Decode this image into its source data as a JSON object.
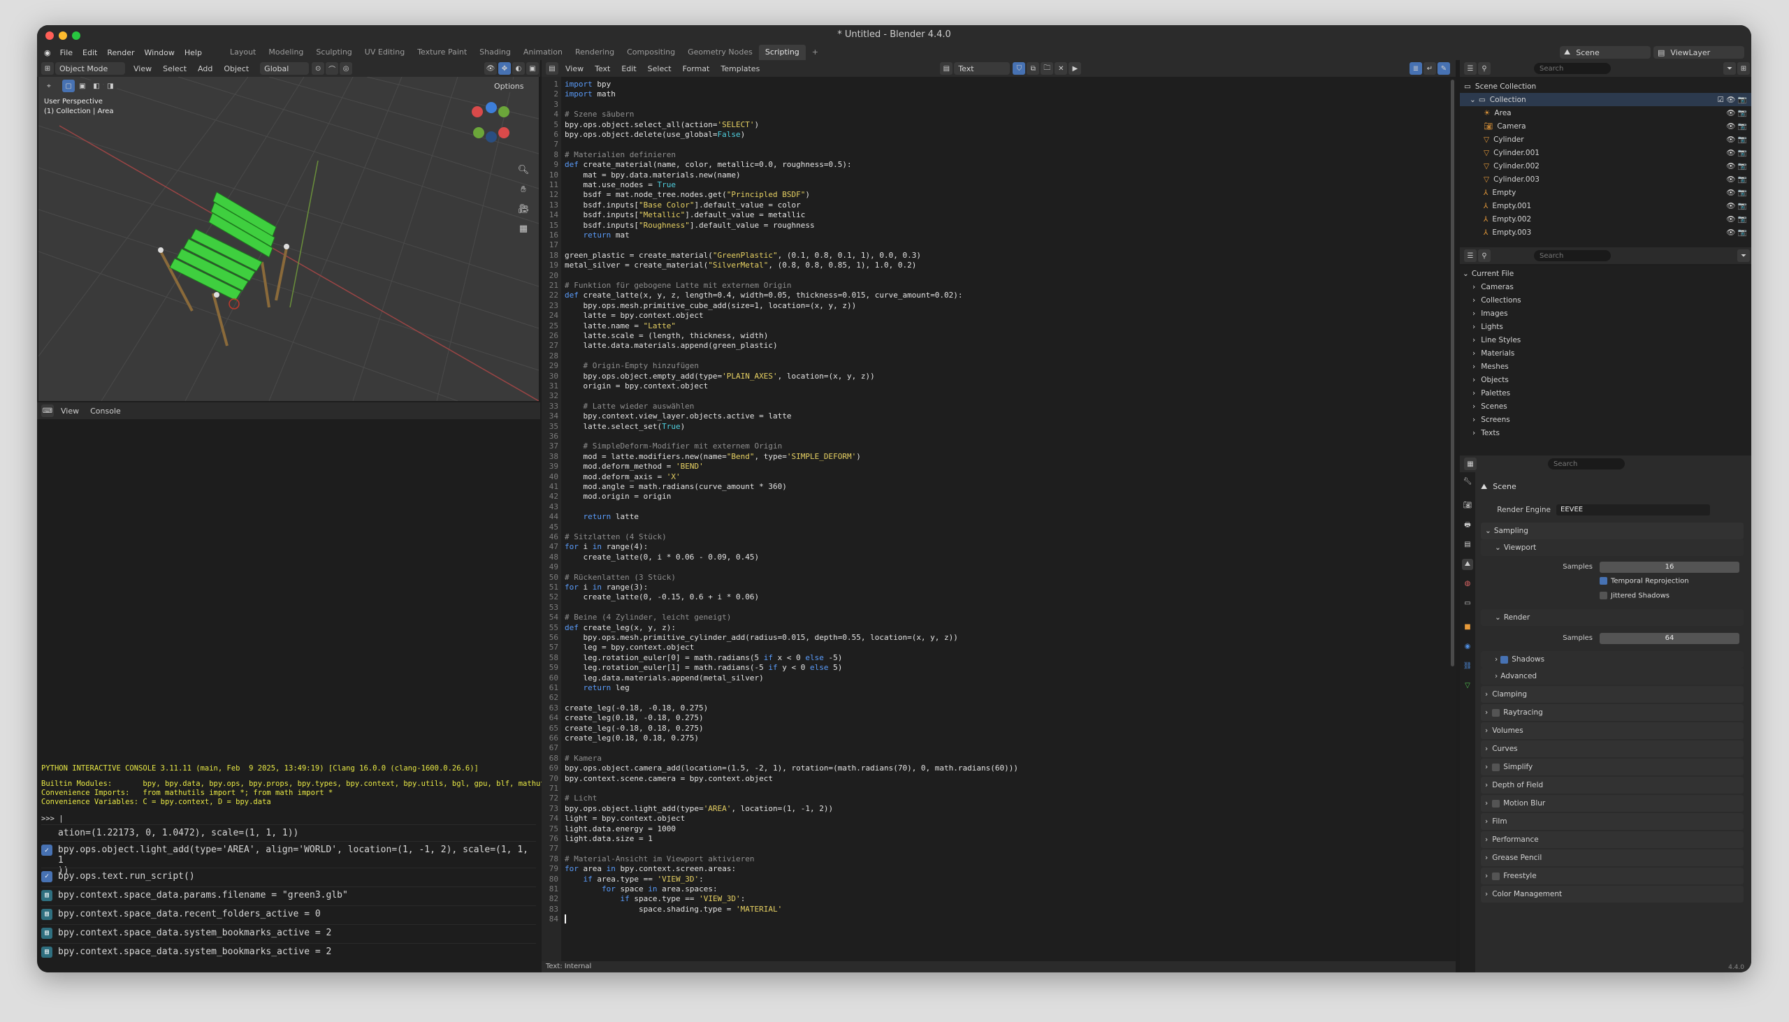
{
  "window_title": "* Untitled - Blender 4.4.0",
  "version": "4.4.0",
  "menu": [
    "File",
    "Edit",
    "Render",
    "Window",
    "Help"
  ],
  "workspaces": [
    "Layout",
    "Modeling",
    "Sculpting",
    "UV Editing",
    "Texture Paint",
    "Shading",
    "Animation",
    "Rendering",
    "Compositing",
    "Geometry Nodes",
    "Scripting"
  ],
  "active_workspace": "Scripting",
  "scene_name": "Scene",
  "view_layer": "ViewLayer",
  "viewport": {
    "mode": "Object Mode",
    "menus": [
      "View",
      "Select",
      "Add",
      "Object"
    ],
    "orientation": "Global",
    "options": "Options",
    "label_perspective": "User Perspective",
    "label_collection": "(1) Collection | Area"
  },
  "console": {
    "menus": [
      "View",
      "Console"
    ],
    "banner": "PYTHON INTERACTIVE CONSOLE 3.11.11 (main, Feb  9 2025, 13:49:19) [Clang 16.0.0 (clang-1600.0.26.6)]",
    "builtin": "Builtin Modules:       bpy, bpy.data, bpy.ops, bpy.props, bpy.types, bpy.context, bpy.utils, bgl, gpu, blf, mathutils",
    "imports": "Convenience Imports:   from mathutils import *; from math import *",
    "variables": "Convenience Variables: C = bpy.context, D = bpy.data",
    "prompt": ">>> |",
    "history": [
      "ation=(1.22173, 0, 1.0472), scale=(1, 1, 1))",
      "bpy.ops.object.light_add(type='AREA', align='WORLD', location=(1, -1, 2), scale=(1, 1, 1",
      "))",
      "bpy.ops.text.run_script()",
      "bpy.context.space_data.params.filename = \"green3.glb\"",
      "bpy.context.space_data.recent_folders_active = 0",
      "bpy.context.space_data.system_bookmarks_active = 2",
      "bpy.context.space_data.system_bookmarks_active = 2"
    ]
  },
  "editor": {
    "menus": [
      "View",
      "Text",
      "Edit",
      "Select",
      "Format",
      "Templates"
    ],
    "text_name": "Text",
    "footer": "Text: Internal"
  },
  "code": [
    "import bpy",
    "import math",
    "",
    "# Szene säubern",
    "bpy.ops.object.select_all(action='SELECT')",
    "bpy.ops.object.delete(use_global=False)",
    "",
    "# Materialien definieren",
    "def create_material(name, color, metallic=0.0, roughness=0.5):",
    "    mat = bpy.data.materials.new(name)",
    "    mat.use_nodes = True",
    "    bsdf = mat.node_tree.nodes.get(\"Principled BSDF\")",
    "    bsdf.inputs[\"Base Color\"].default_value = color",
    "    bsdf.inputs[\"Metallic\"].default_value = metallic",
    "    bsdf.inputs[\"Roughness\"].default_value = roughness",
    "    return mat",
    "",
    "green_plastic = create_material(\"GreenPlastic\", (0.1, 0.8, 0.1, 1), 0.0, 0.3)",
    "metal_silver = create_material(\"SilverMetal\", (0.8, 0.8, 0.85, 1), 1.0, 0.2)",
    "",
    "# Funktion für gebogene Latte mit externem Origin",
    "def create_latte(x, y, z, length=0.4, width=0.05, thickness=0.015, curve_amount=0.02):",
    "    bpy.ops.mesh.primitive_cube_add(size=1, location=(x, y, z))",
    "    latte = bpy.context.object",
    "    latte.name = \"Latte\"",
    "    latte.scale = (length, thickness, width)",
    "    latte.data.materials.append(green_plastic)",
    "",
    "    # Origin-Empty hinzufügen",
    "    bpy.ops.object.empty_add(type='PLAIN_AXES', location=(x, y, z))",
    "    origin = bpy.context.object",
    "",
    "    # Latte wieder auswählen",
    "    bpy.context.view_layer.objects.active = latte",
    "    latte.select_set(True)",
    "",
    "    # SimpleDeform-Modifier mit externem Origin",
    "    mod = latte.modifiers.new(name=\"Bend\", type='SIMPLE_DEFORM')",
    "    mod.deform_method = 'BEND'",
    "    mod.deform_axis = 'X'",
    "    mod.angle = math.radians(curve_amount * 360)",
    "    mod.origin = origin",
    "",
    "    return latte",
    "",
    "# Sitzlatten (4 Stück)",
    "for i in range(4):",
    "    create_latte(0, i * 0.06 - 0.09, 0.45)",
    "",
    "# Rückenlatten (3 Stück)",
    "for i in range(3):",
    "    create_latte(0, -0.15, 0.6 + i * 0.06)",
    "",
    "# Beine (4 Zylinder, leicht geneigt)",
    "def create_leg(x, y, z):",
    "    bpy.ops.mesh.primitive_cylinder_add(radius=0.015, depth=0.55, location=(x, y, z))",
    "    leg = bpy.context.object",
    "    leg.rotation_euler[0] = math.radians(5 if x < 0 else -5)",
    "    leg.rotation_euler[1] = math.radians(-5 if y < 0 else 5)",
    "    leg.data.materials.append(metal_silver)",
    "    return leg",
    "",
    "create_leg(-0.18, -0.18, 0.275)",
    "create_leg(0.18, -0.18, 0.275)",
    "create_leg(-0.18, 0.18, 0.275)",
    "create_leg(0.18, 0.18, 0.275)",
    "",
    "# Kamera",
    "bpy.ops.object.camera_add(location=(1.5, -2, 1), rotation=(math.radians(70), 0, math.radians(60)))",
    "bpy.context.scene.camera = bpy.context.object",
    "",
    "# Licht",
    "bpy.ops.object.light_add(type='AREA', location=(1, -1, 2))",
    "light = bpy.context.object",
    "light.data.energy = 1000",
    "light.data.size = 1",
    "",
    "# Material-Ansicht im Viewport aktivieren",
    "for area in bpy.context.screen.areas:",
    "    if area.type == 'VIEW_3D':",
    "        for space in area.spaces:",
    "            if space.type == 'VIEW_3D':",
    "                space.shading.type = 'MATERIAL'",
    ""
  ],
  "outliner": {
    "root": "Scene Collection",
    "collection": "Collection",
    "items": [
      "Area",
      "Camera",
      "Cylinder",
      "Cylinder.001",
      "Cylinder.002",
      "Cylinder.003",
      "Empty",
      "Empty.001",
      "Empty.002",
      "Empty.003"
    ],
    "search_placeholder": "Search"
  },
  "blend_data": {
    "root": "Current File",
    "items": [
      "Cameras",
      "Collections",
      "Images",
      "Lights",
      "Line Styles",
      "Materials",
      "Meshes",
      "Objects",
      "Palettes",
      "Scenes",
      "Screens",
      "Texts"
    ]
  },
  "props": {
    "scene": "Scene",
    "render_engine_label": "Render Engine",
    "render_engine": "EEVEE",
    "sampling": "Sampling",
    "viewport": "Viewport",
    "samples_label": "Samples",
    "viewport_samples": "16",
    "temporal": "Temporal Reprojection",
    "jittered": "Jittered Shadows",
    "render": "Render",
    "render_samples": "64",
    "shadows": "Shadows",
    "advanced": "Advanced",
    "panels": [
      "Clamping",
      "Raytracing",
      "Volumes",
      "Curves",
      "Simplify",
      "Depth of Field",
      "Motion Blur",
      "Film",
      "Performance",
      "Grease Pencil",
      "Freestyle",
      "Color Management"
    ]
  },
  "colors": {
    "accent": "#4772b3",
    "green": "#3fcf3f",
    "keyword": "#5a9cfb",
    "string": "#e7d163"
  }
}
